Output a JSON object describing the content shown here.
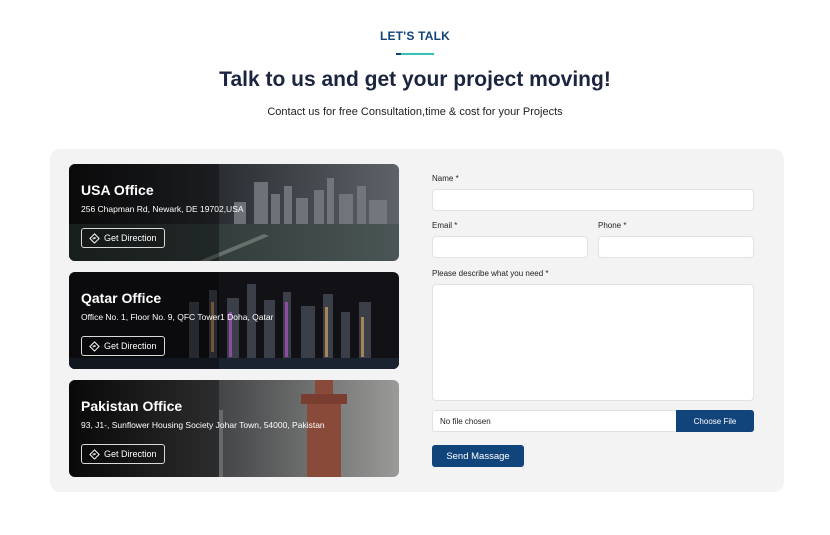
{
  "header": {
    "eyebrow": "LET'S TALK",
    "title": "Talk to us and get your project moving!",
    "subtitle": "Contact us for free Consultation,time & cost for your Projects"
  },
  "offices": [
    {
      "name": "USA Office",
      "address": "256 Chapman Rd, Newark, DE 19702,USA",
      "button_label": "Get Direction"
    },
    {
      "name": "Qatar Office",
      "address": "Office No. 1, Floor No. 9, QFC Tower1 Doha, Qatar",
      "button_label": "Get Direction"
    },
    {
      "name": "Pakistan Office",
      "address": "93, J1-, Sunflower Housing Society Johar Town, 54000, Pakistan",
      "button_label": "Get Direction"
    }
  ],
  "form": {
    "name_label": "Name *",
    "email_label": "Email *",
    "phone_label": "Phone *",
    "describe_label": "Please describe what you need *",
    "file_status": "No file chosen",
    "choose_file_label": "Choose File",
    "submit_label": "Send Massage"
  },
  "colors": {
    "accent": "#12447c",
    "underline_teal": "#34c3b0",
    "panel_bg": "#f3f3f4"
  }
}
